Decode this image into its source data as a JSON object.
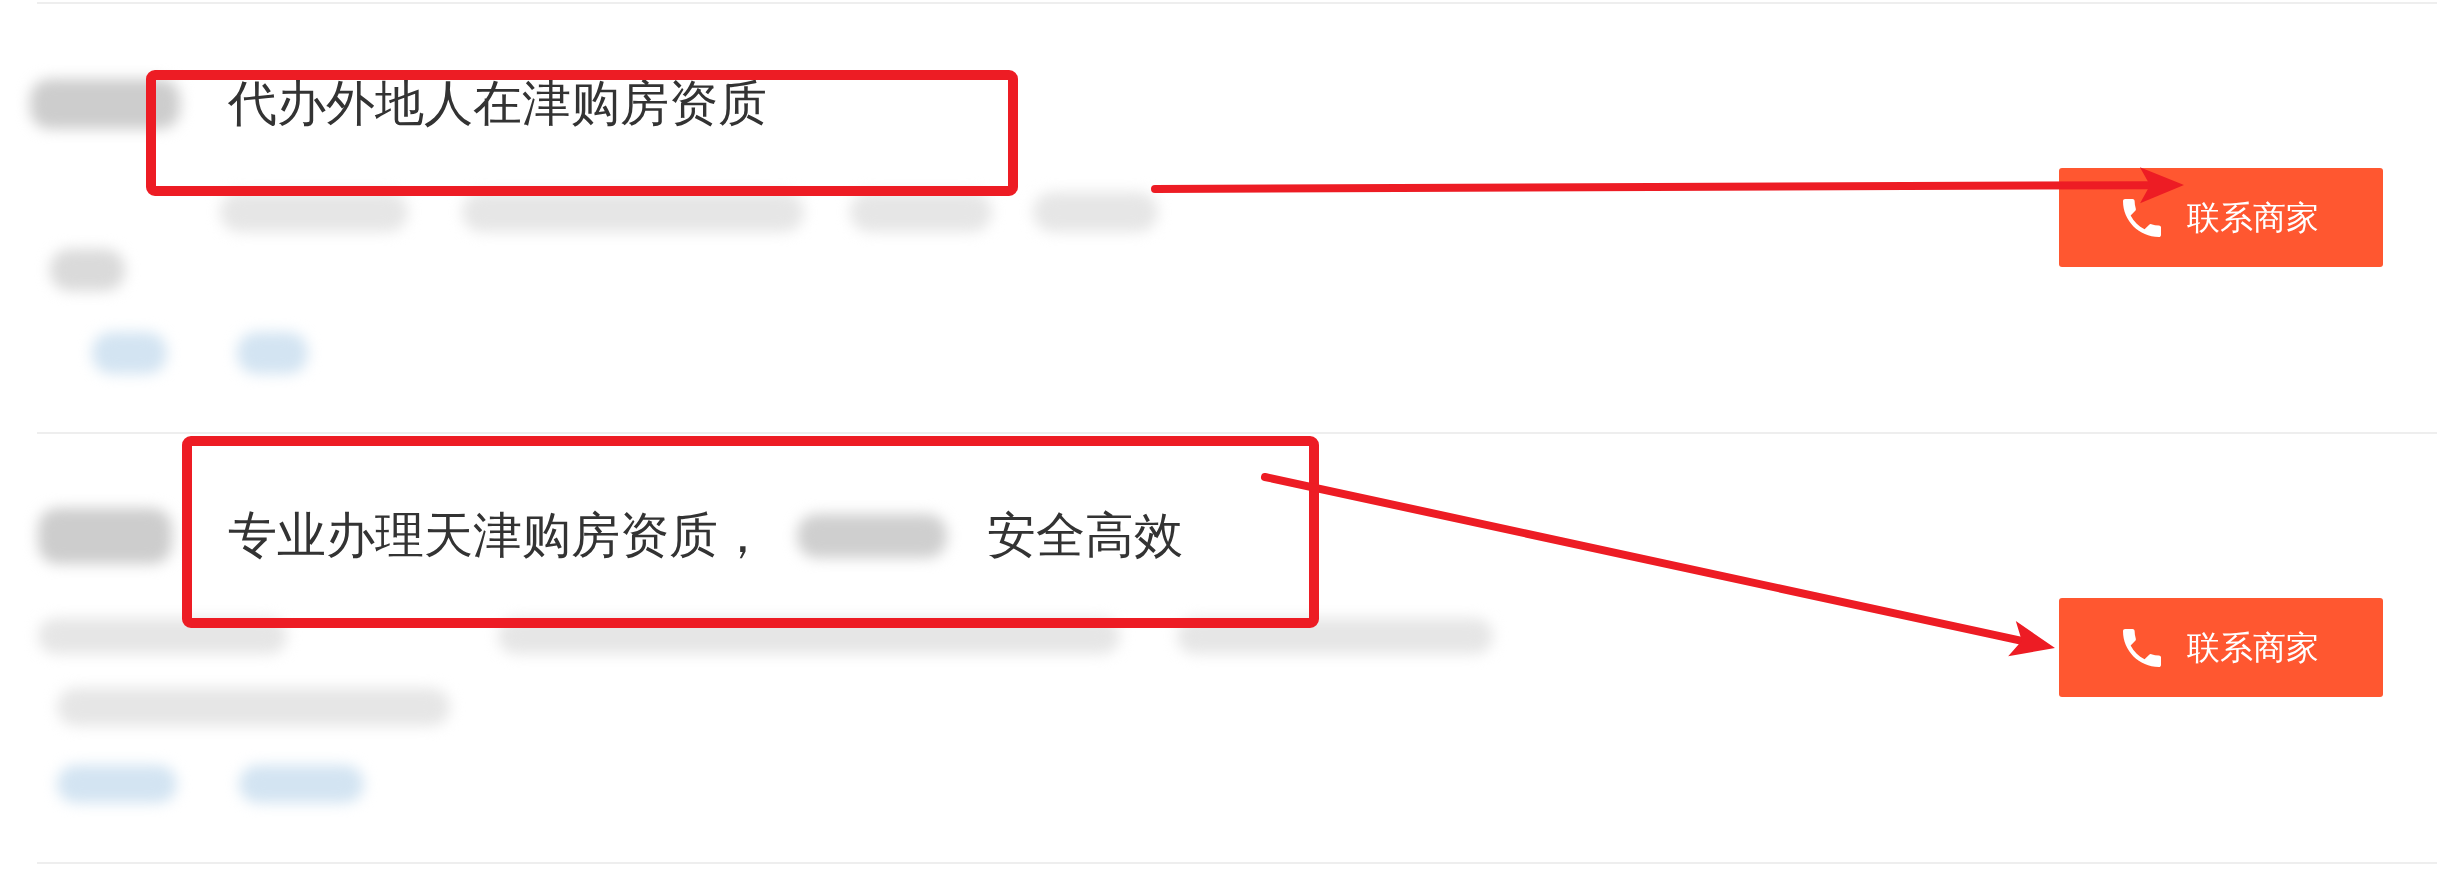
{
  "items": [
    {
      "title_segments": [
        {
          "kind": "text",
          "text": "代办外地人在津购房资质"
        }
      ],
      "highlighted": true,
      "contact_button": {
        "label": "联系商家"
      }
    },
    {
      "title_segments": [
        {
          "kind": "text",
          "text": "专业办理天津购房资质，"
        },
        {
          "kind": "redacted"
        },
        {
          "kind": "text",
          "text": "安全高效"
        }
      ],
      "highlighted": true,
      "contact_button": {
        "label": "联系商家"
      }
    }
  ]
}
